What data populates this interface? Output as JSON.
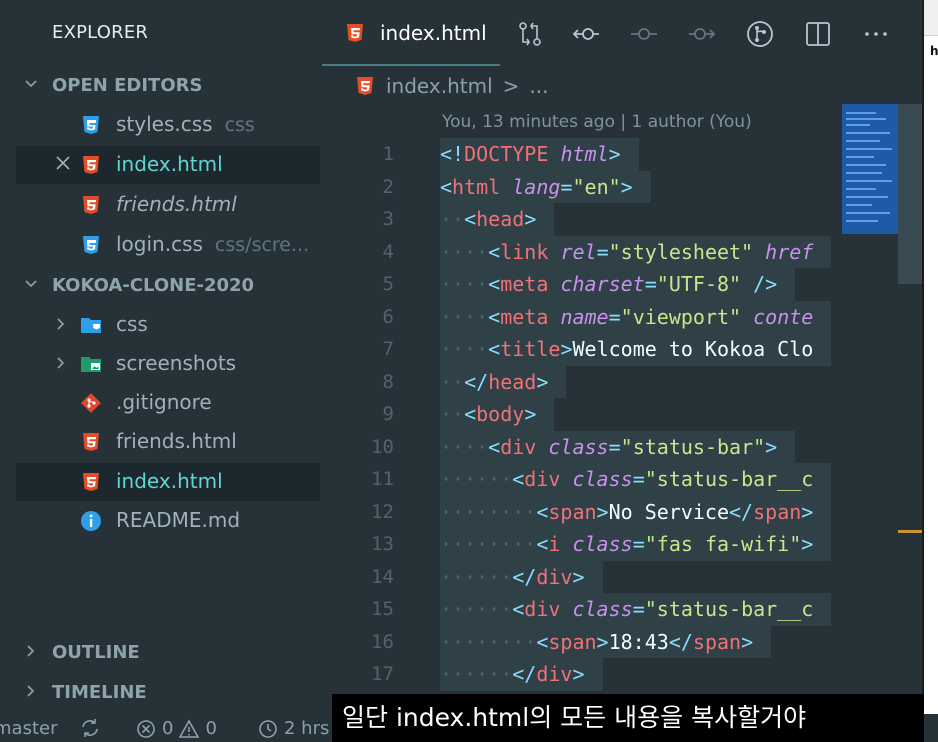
{
  "sidebar": {
    "title": "EXPLORER",
    "open_editors_label": "OPEN EDITORS",
    "open_editors": [
      {
        "name": "styles.css",
        "desc": "css",
        "icon": "css3-icon"
      },
      {
        "name": "index.html",
        "desc": "",
        "icon": "html5-icon"
      },
      {
        "name": "friends.html",
        "desc": "",
        "icon": "html5-icon"
      },
      {
        "name": "login.css",
        "desc": "css/scre...",
        "icon": "css3-icon"
      }
    ],
    "project_label": "KOKOA-CLONE-2020",
    "tree": [
      {
        "name": "css",
        "icon": "folder-css-icon"
      },
      {
        "name": "screenshots",
        "icon": "folder-images-icon"
      },
      {
        "name": ".gitignore",
        "icon": "git-icon"
      },
      {
        "name": "friends.html",
        "icon": "html5-icon"
      },
      {
        "name": "index.html",
        "icon": "html5-icon"
      },
      {
        "name": "README.md",
        "icon": "info-icon"
      }
    ],
    "outline_label": "OUTLINE",
    "timeline_label": "TIMELINE"
  },
  "editor": {
    "tab_label": "index.html",
    "breadcrumb_file": "index.html",
    "breadcrumb_sep": ">",
    "breadcrumb_more": "...",
    "blame": "You, 13 minutes ago | 1 author (You)",
    "line_numbers": [
      "1",
      "2",
      "3",
      "4",
      "5",
      "6",
      "7",
      "8",
      "9",
      "10",
      "11",
      "12",
      "13",
      "14",
      "15",
      "16",
      "17"
    ]
  },
  "statusbar": {
    "branch": "master",
    "errors": "0",
    "warnings": "0",
    "time": "2 hrs"
  },
  "peek": {
    "text": "he"
  },
  "caption": "일단 index.html의 모든 내용을 복사할거야",
  "colors": {
    "background": "#263238",
    "tag": "#f07178",
    "attr": "#c792ea",
    "string": "#c3e88d",
    "punct": "#89ddff",
    "html_icon": "#e44d26",
    "css_icon": "#2e9fe8"
  }
}
